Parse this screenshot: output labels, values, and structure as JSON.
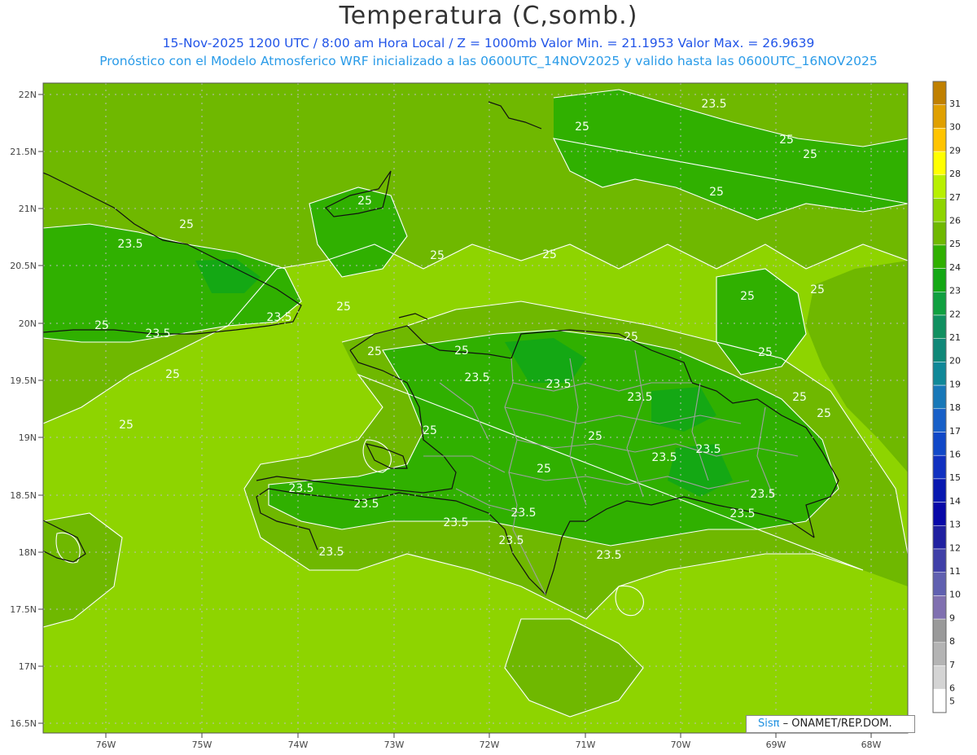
{
  "header": {
    "title": "Temperatura (C,somb.)",
    "line1": "15-Nov-2025  1200 UTC / 8:00 am Hora Local / Z = 1000mb   Valor Min. = 21.1953  Valor Max. = 26.9639",
    "line2": "Pronóstico con el Modelo Atmosferico WRF inicializado a las 0600UTC_14NOV2025 y valido hasta las  0600UTC_16NOV2025"
  },
  "map": {
    "lat_labels": [
      "22N",
      "21.5N",
      "21N",
      "20.5N",
      "20N",
      "19.5N",
      "19N",
      "18.5N",
      "18N",
      "17.5N",
      "17N",
      "16.5N"
    ],
    "lon_labels": [
      "76W",
      "75W",
      "74W",
      "73W",
      "72W",
      "71W",
      "70W",
      "69W",
      "68W"
    ],
    "contour_labels": [
      "25",
      "25",
      "25",
      "25",
      "25",
      "25",
      "25",
      "25",
      "25",
      "25",
      "25",
      "25",
      "25",
      "25",
      "25",
      "25",
      "25",
      "25",
      "25",
      "25",
      "25",
      "25",
      "25",
      "23.5",
      "23.5",
      "23.5",
      "23.5",
      "23.5",
      "23.5",
      "23.5",
      "23.5",
      "23.5",
      "23.5",
      "23.5"
    ],
    "background_color": "#8ed400"
  },
  "colorbar": {
    "levels": [
      "31",
      "30",
      "29",
      "28",
      "27",
      "26",
      "25",
      "24",
      "23",
      "22",
      "21",
      "20",
      "19",
      "18",
      "17",
      "16",
      "15",
      "14",
      "13",
      "12",
      "11",
      "10",
      "9",
      "8",
      "7",
      "6",
      "5"
    ],
    "colors": [
      "#c08000",
      "#e0a000",
      "#ffc400",
      "#ffff00",
      "#b8f000",
      "#8ed400",
      "#6fb800",
      "#30b000",
      "#14a814",
      "#10a040",
      "#109060",
      "#108878",
      "#108898",
      "#1878b8",
      "#1860c8",
      "#1048c8",
      "#1030c0",
      "#0818b0",
      "#0808a8",
      "#2020a0",
      "#4040a8",
      "#6060b0",
      "#8070b0",
      "#9a9a9a",
      "#b4b4b4",
      "#d4d4d4",
      "#ffffff"
    ]
  },
  "credit": {
    "sis": "Sisπ",
    "rest": " – ONAMET/REP.DOM."
  }
}
